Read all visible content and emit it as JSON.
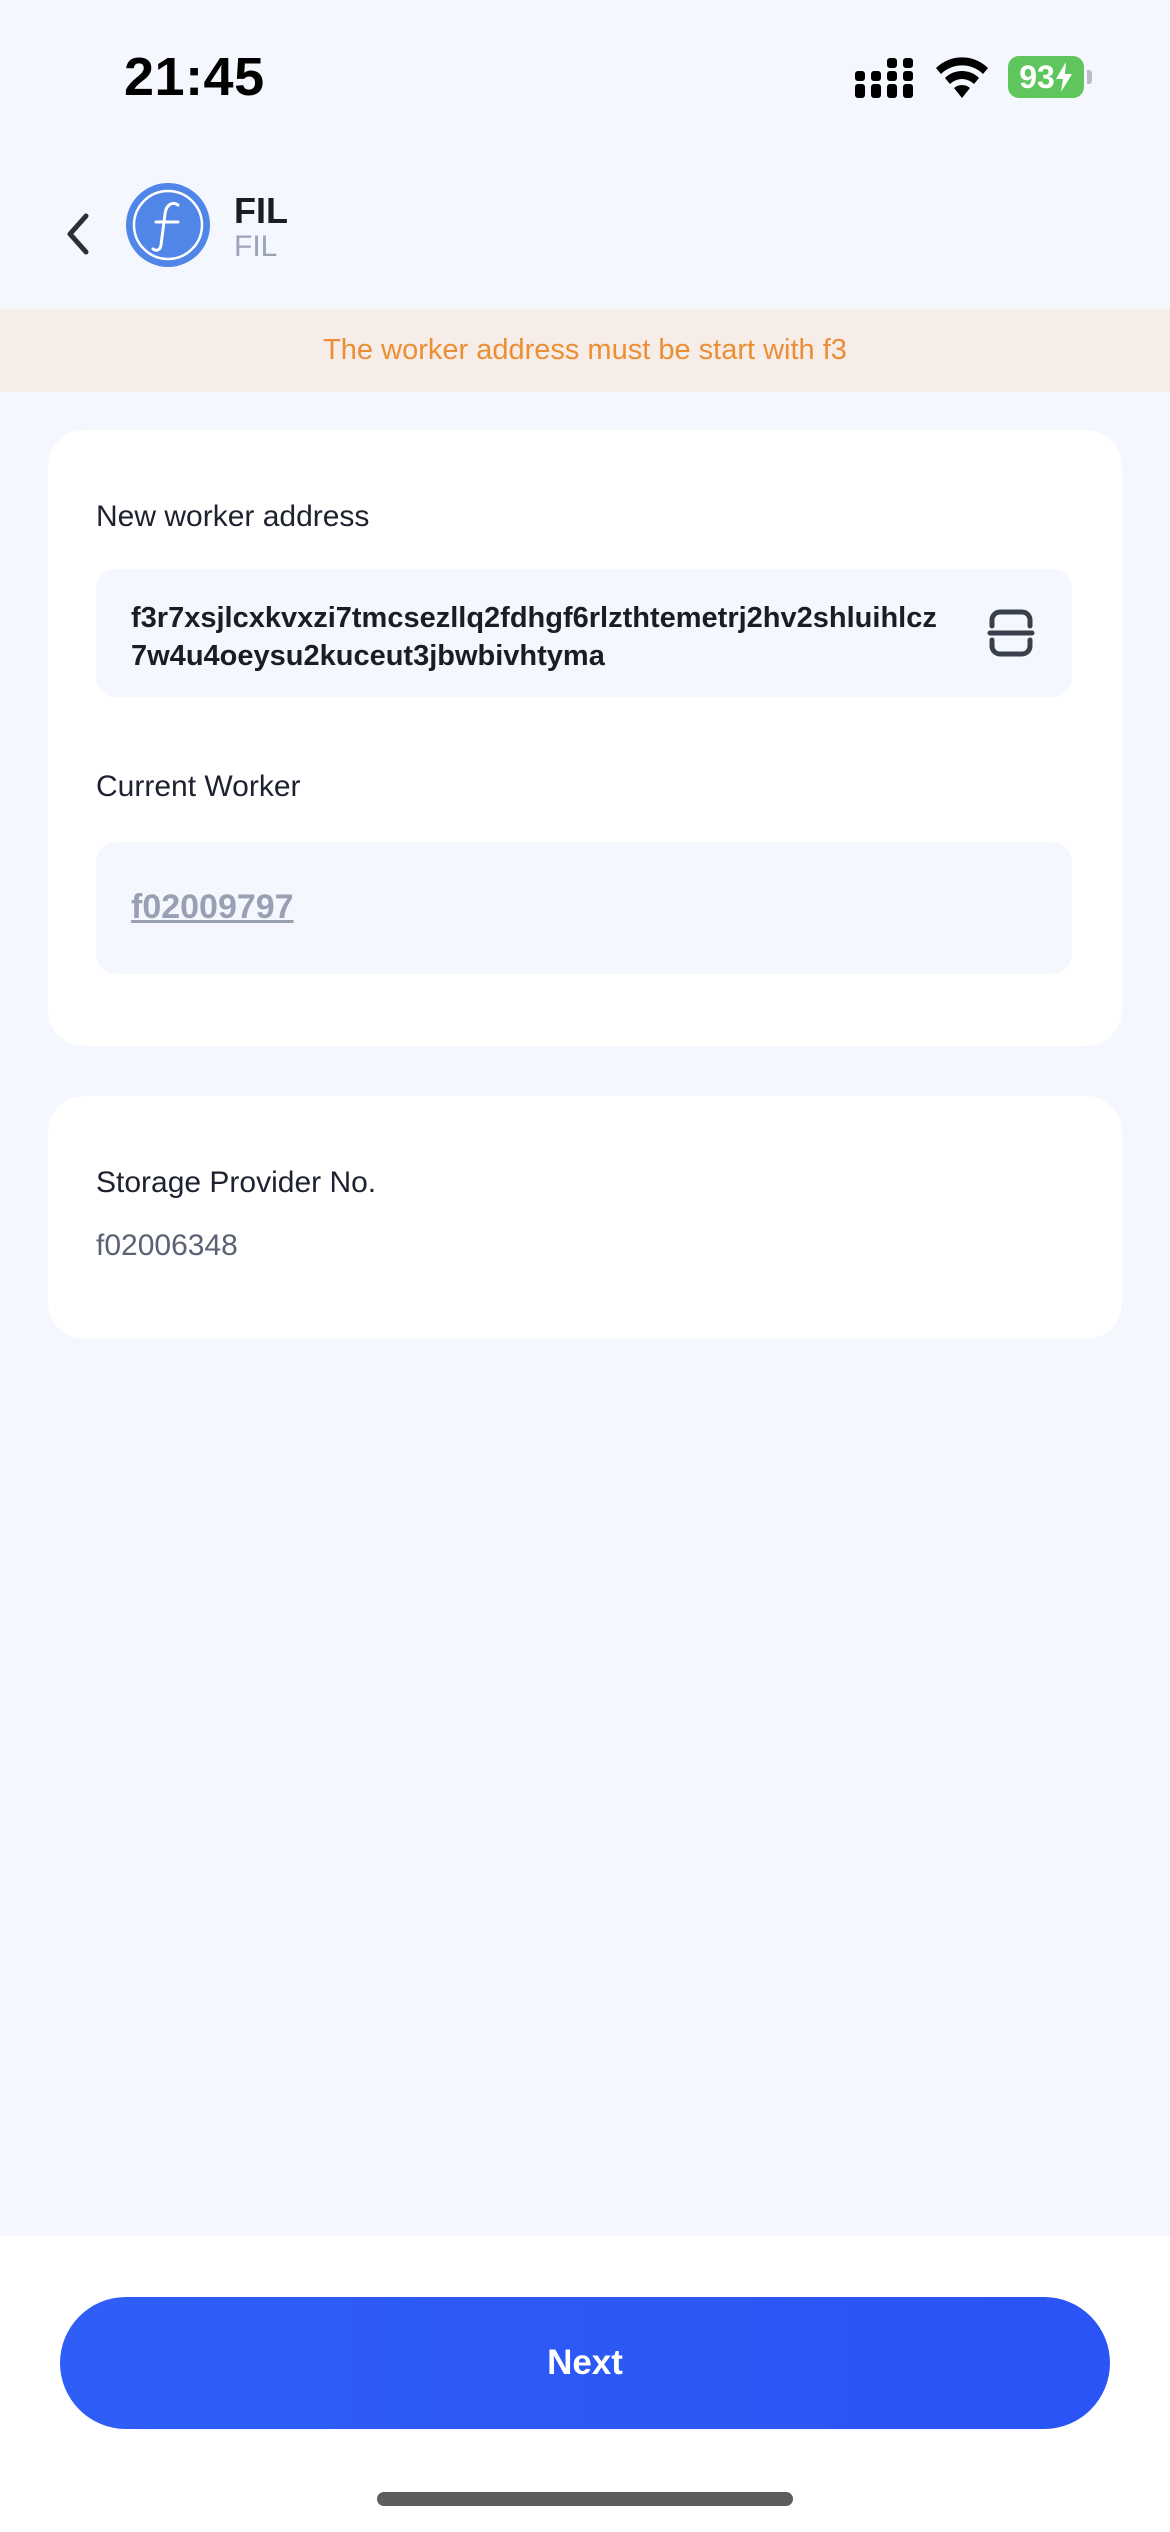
{
  "status_bar": {
    "time": "21:45",
    "battery_level": "93",
    "icons": [
      "signal-icon",
      "wifi-icon",
      "battery-charging-icon"
    ]
  },
  "header": {
    "back_icon": "chevron-left-icon",
    "coin_icon": "filecoin-logo-icon",
    "coin_name": "FIL",
    "coin_symbol": "FIL"
  },
  "warning": {
    "text": "The worker address must be start with f3",
    "color": "#ec8f34"
  },
  "worker_form": {
    "new_worker_label": "New worker address",
    "new_worker_value": "f3r7xsjlcxkvxzi7tmcsezllq2fdhgf6rlzthtemetrj2hv2shluihlcz7w4u4oeysu2kuceut3jbwbivhtyma",
    "scan_icon": "scan-icon",
    "current_worker_label": "Current Worker",
    "current_worker_value": "f02009797"
  },
  "provider": {
    "label": "Storage Provider No.",
    "value": "f02006348"
  },
  "footer": {
    "next_label": "Next",
    "accent_color": "#2f5ef6"
  }
}
